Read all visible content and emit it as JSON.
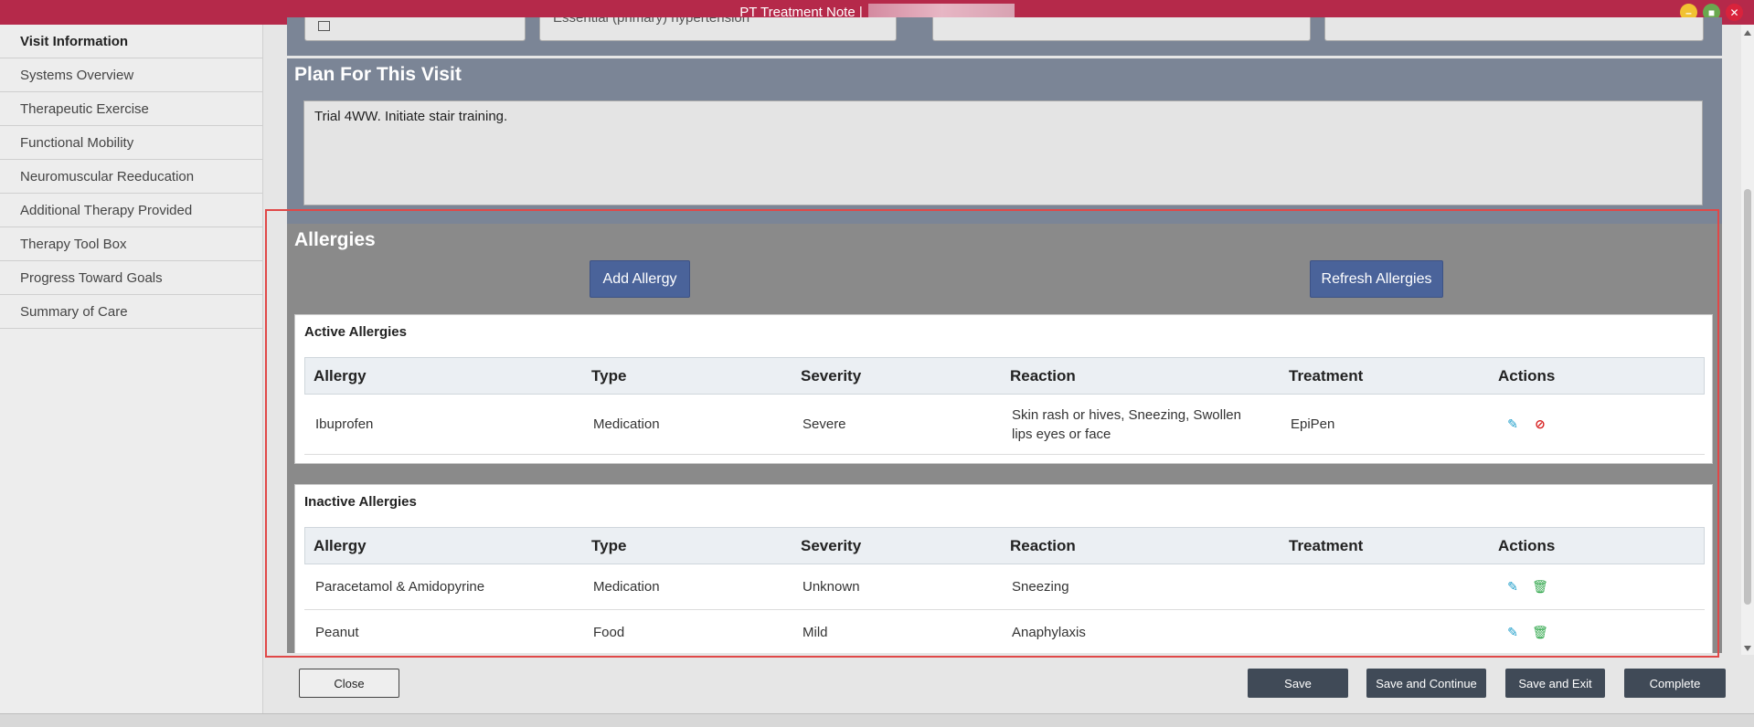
{
  "window": {
    "title": "PT Treatment Note |"
  },
  "sidebar": {
    "items": [
      {
        "label": "Visit Information"
      },
      {
        "label": "Systems Overview"
      },
      {
        "label": "Therapeutic Exercise"
      },
      {
        "label": "Functional Mobility"
      },
      {
        "label": "Neuromuscular Reeducation"
      },
      {
        "label": "Additional Therapy Provided"
      },
      {
        "label": "Therapy Tool Box"
      },
      {
        "label": "Progress Toward Goals"
      },
      {
        "label": "Summary of Care"
      }
    ]
  },
  "diagnosis": {
    "value": "Essential (primary) hypertension"
  },
  "plan": {
    "title": "Plan For This Visit",
    "text": "Trial 4WW. Initiate stair training."
  },
  "allergies": {
    "title": "Allergies",
    "add_label": "Add Allergy",
    "refresh_label": "Refresh Allergies",
    "columns": [
      "Allergy",
      "Type",
      "Severity",
      "Reaction",
      "Treatment",
      "Actions"
    ],
    "active": {
      "title": "Active Allergies",
      "rows": [
        {
          "allergy": "Ibuprofen",
          "type": "Medication",
          "severity": "Severe",
          "reaction": "Skin rash or hives, Sneezing, Swollen lips eyes or face",
          "treatment": "EpiPen"
        }
      ]
    },
    "inactive": {
      "title": "Inactive Allergies",
      "rows": [
        {
          "allergy": "Paracetamol & Amidopyrine",
          "type": "Medication",
          "severity": "Unknown",
          "reaction": "Sneezing",
          "treatment": ""
        },
        {
          "allergy": "Peanut",
          "type": "Food",
          "severity": "Mild",
          "reaction": "Anaphylaxis",
          "treatment": ""
        }
      ]
    }
  },
  "footer": {
    "close_label": "Close",
    "save_label": "Save",
    "save_continue_label": "Save and Continue",
    "save_exit_label": "Save and Exit",
    "complete_label": "Complete"
  },
  "colors": {
    "titlebar": "#b5294a",
    "panel": "#7b8596",
    "accent_button": "#4a639a",
    "dark_button": "#404a57",
    "highlight": "#e04848"
  }
}
